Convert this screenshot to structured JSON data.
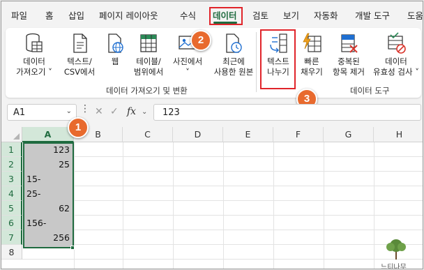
{
  "menu": {
    "tabs": [
      "파일",
      "홈",
      "삽입",
      "페이지 레이아웃",
      "수식",
      "데이터",
      "검토",
      "보기",
      "자동화",
      "개발 도구",
      "도움"
    ],
    "active_tab": "데이터"
  },
  "ribbon": {
    "get_data": [
      "데이터",
      "가져오기 ˅"
    ],
    "text_csv": [
      "텍스트/",
      "CSV에서"
    ],
    "web": "웹",
    "table_range": [
      "테이블/",
      "범위에서"
    ],
    "from_picture": [
      "사진에서",
      "˅"
    ],
    "recent_sources": [
      "최근에",
      "사용한 원본"
    ],
    "group_get_transform": "데이터 가져오기 및 변환",
    "text_to_columns": [
      "텍스트",
      "나누기"
    ],
    "flash_fill": [
      "빠른",
      "채우기"
    ],
    "remove_duplicates": [
      "중복된",
      "항목 제거"
    ],
    "data_validation": [
      "데이터",
      "유효성 검사 ˅"
    ],
    "group_data_tools": "데이터 도구"
  },
  "badges": [
    "1",
    "2",
    "3"
  ],
  "formula_bar": {
    "name_box": "A1",
    "name_box_chevron": "⌄",
    "menu_dots": "⋮",
    "cancel": "✕",
    "enter": "✓",
    "fx": "fx",
    "fx_chevron": "⌄",
    "value": "123"
  },
  "grid": {
    "columns": [
      "A",
      "B",
      "C",
      "D",
      "E",
      "F",
      "G",
      "H"
    ],
    "rows": [
      "1",
      "2",
      "3",
      "4",
      "5",
      "6",
      "7",
      "8"
    ],
    "cells_col_a": [
      {
        "value": "123",
        "align": "right"
      },
      {
        "value": "25",
        "align": "right"
      },
      {
        "value": "15-",
        "align": "left"
      },
      {
        "value": "25-",
        "align": "left"
      },
      {
        "value": "62",
        "align": "right"
      },
      {
        "value": "156-",
        "align": "left"
      },
      {
        "value": "256",
        "align": "right"
      }
    ]
  },
  "watermark": "느티나무",
  "colors": {
    "excel_green": "#1f6b3f",
    "highlight_red": "#e0242a",
    "badge_orange": "#e86a2e",
    "selection_grey": "#c8c8c8"
  }
}
